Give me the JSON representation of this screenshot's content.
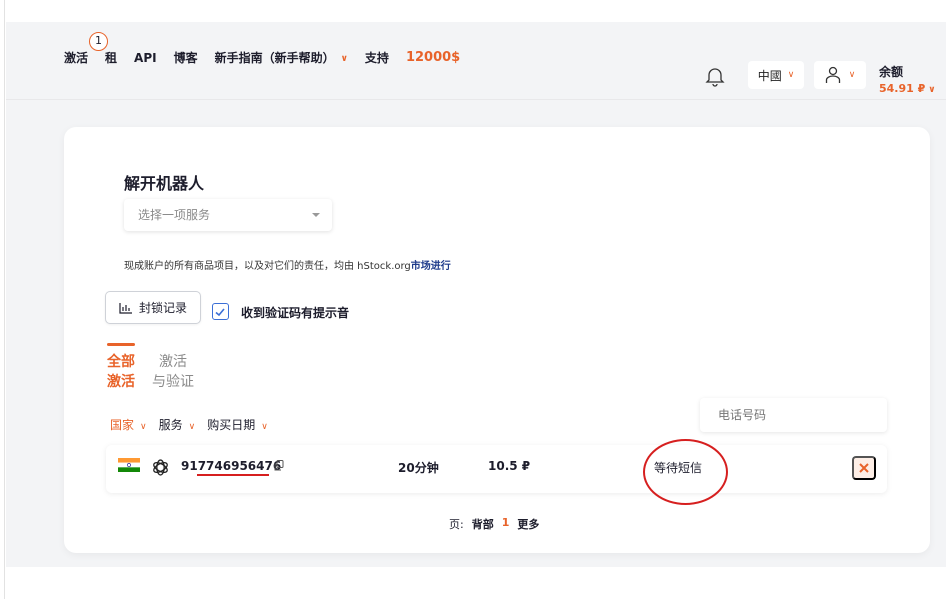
{
  "nav": {
    "activation": "激活",
    "activation_badge": "1",
    "rent": "租",
    "api": "API",
    "blog": "博客",
    "guide": "新手指南（新手帮助）",
    "support": "支持",
    "promo": "12000$"
  },
  "header": {
    "language": "中國",
    "balance_label": "余额",
    "balance_value": "54.91 ₽"
  },
  "card": {
    "title": "解开机器人",
    "service_placeholder": "选择一项服务",
    "notice_text": "现成账户的所有商品项目，以及对它们的责任，均由 hStock.org",
    "notice_link": "市场进行",
    "block_button": "封锁记录",
    "sound_label": "收到验证码有提示音"
  },
  "tabs": {
    "all_line1": "全部",
    "all_line2": "激活",
    "activation_line1": "激活",
    "activation_line2": "与验证"
  },
  "search": {
    "placeholder": "电话号码"
  },
  "filters": [
    {
      "label": "国家",
      "active": true
    },
    {
      "label": "服务",
      "active": false
    },
    {
      "label": "购买日期",
      "active": false
    }
  ],
  "order": {
    "country_flag": "india-flag",
    "service_icon": "openai-icon",
    "phone_prefix": "91",
    "phone_rest": "7746956476",
    "duration": "20分钟",
    "price": "10.5 ₽",
    "status": "等待短信"
  },
  "pagination": {
    "label": "页:",
    "back": "背部",
    "current": "1",
    "more": "更多"
  },
  "colors": {
    "accent": "#e8632a",
    "annotation_red": "#d61f1f",
    "background": "#f3f4f6"
  }
}
